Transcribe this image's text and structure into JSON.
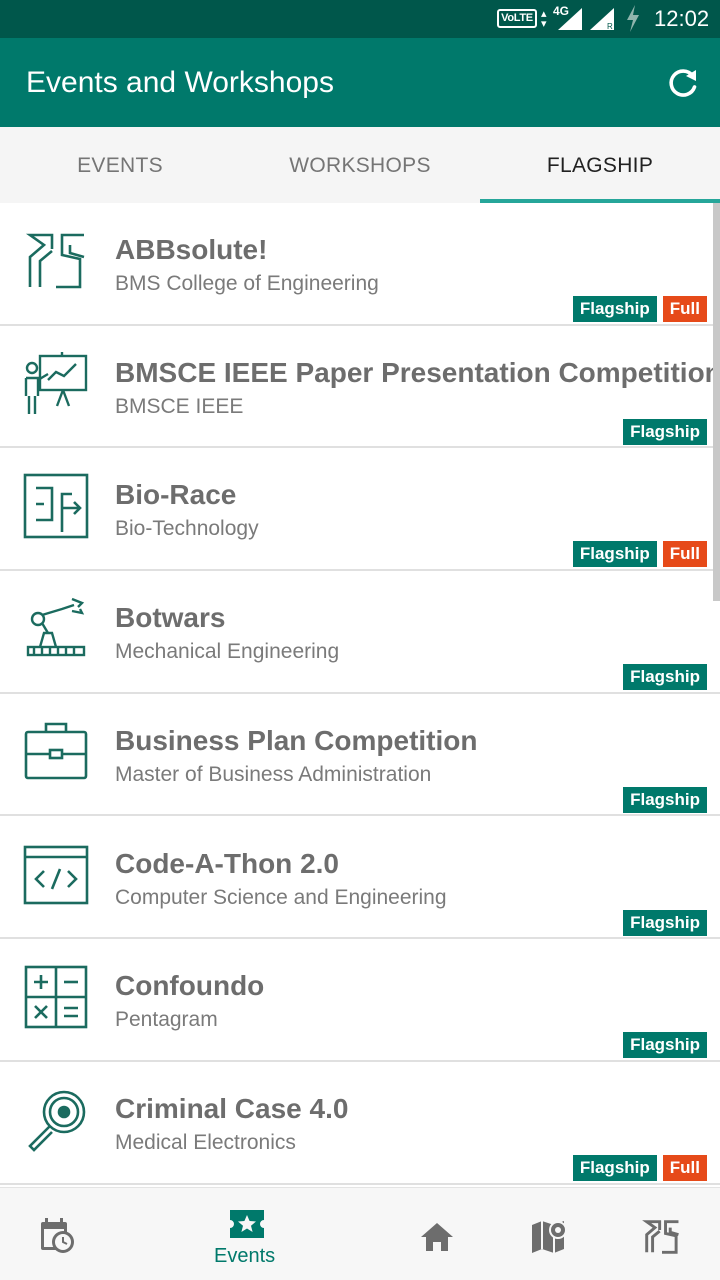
{
  "status_bar": {
    "volte": "VoLTE",
    "network": "4G",
    "time": "12:02",
    "icons": [
      "volte-icon",
      "data-arrows-icon",
      "signal-4g-icon",
      "signal-icon",
      "charging-icon"
    ]
  },
  "app_bar": {
    "title": "Events and Workshops",
    "refresh_icon": "refresh-icon"
  },
  "tabs": [
    {
      "label": "EVENTS",
      "active": false
    },
    {
      "label": "WORKSHOPS",
      "active": false
    },
    {
      "label": "FLAGSHIP",
      "active": true
    }
  ],
  "events": [
    {
      "name": "ABBsolute!",
      "dept": "BMS College of Engineering",
      "icon": "abbsolute-logo-icon",
      "badges": [
        "Flagship",
        "Full"
      ]
    },
    {
      "name": "BMSCE IEEE Paper Presentation Competition",
      "dept": "BMSCE IEEE",
      "icon": "presentation-icon",
      "badges": [
        "Flagship"
      ]
    },
    {
      "name": "Bio-Race",
      "dept": "Bio-Technology",
      "icon": "maze-icon",
      "badges": [
        "Flagship",
        "Full"
      ]
    },
    {
      "name": "Botwars",
      "dept": "Mechanical Engineering",
      "icon": "robot-arm-icon",
      "badges": [
        "Flagship"
      ]
    },
    {
      "name": "Business Plan Competition",
      "dept": "Master of Business Administration",
      "icon": "briefcase-icon",
      "badges": [
        "Flagship"
      ]
    },
    {
      "name": "Code-A-Thon 2.0",
      "dept": "Computer Science and Engineering",
      "icon": "code-icon",
      "badges": [
        "Flagship"
      ]
    },
    {
      "name": "Confoundo",
      "dept": "Pentagram",
      "icon": "calculator-icon",
      "badges": [
        "Flagship"
      ]
    },
    {
      "name": "Criminal Case 4.0",
      "dept": "Medical Electronics",
      "icon": "magnifier-icon",
      "badges": [
        "Flagship",
        "Full"
      ]
    }
  ],
  "bottom_nav": [
    {
      "icon": "calendar-clock-icon",
      "label": ""
    },
    {
      "icon": "events-star-icon",
      "label": "Events",
      "active": true
    },
    {
      "icon": "home-icon",
      "label": ""
    },
    {
      "icon": "map-icon",
      "label": ""
    },
    {
      "icon": "abbsolute-logo-icon",
      "label": ""
    }
  ],
  "colors": {
    "status_bar": "#00574b",
    "primary": "#00796b",
    "accent": "#26a69a",
    "full_badge": "#e64a19"
  }
}
